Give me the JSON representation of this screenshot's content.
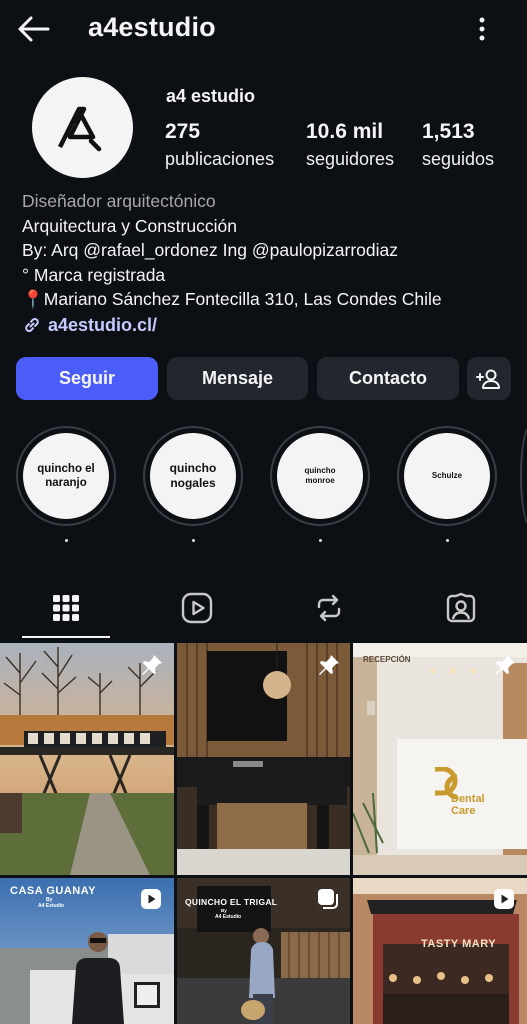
{
  "header": {
    "username": "a4estudio"
  },
  "profile": {
    "display_name": "a4 estudio",
    "stats": [
      {
        "value": "275",
        "label": "publicaciones"
      },
      {
        "value": "10.6 mil",
        "label": "seguidores"
      },
      {
        "value": "1,513",
        "label": "seguidos"
      }
    ],
    "category": "Diseñador arquitectónico",
    "bio": [
      "Arquitectura y Construcción",
      "By: Arq @rafael_ordonez Ing @paulopizarrodiaz",
      "° Marca registrada",
      "📍Mariano Sánchez Fontecilla 310, Las Condes Chile"
    ],
    "link": "a4estudio.cl/"
  },
  "actions": {
    "follow": "Seguir",
    "message": "Mensaje",
    "contact": "Contacto"
  },
  "highlights": [
    {
      "label": "quincho el naranjo"
    },
    {
      "label": "quincho nogales"
    },
    {
      "label": "quincho monroe"
    },
    {
      "label": "Schulze"
    }
  ],
  "tabs": [
    "grid",
    "reels",
    "reposts",
    "tagged"
  ],
  "posts": [
    {
      "type": "pinned"
    },
    {
      "type": "pinned"
    },
    {
      "type": "pinned",
      "sign": "RECEPCIÓN",
      "logo_line1": "Dental",
      "logo_line2": "Care"
    },
    {
      "type": "reel",
      "title": "CASA GUANAY",
      "by": "By",
      "studio": "A4 Estudio"
    },
    {
      "type": "reel",
      "title": "QUINCHO EL TRIGAL",
      "by": "By",
      "studio": "A4 Estudio"
    },
    {
      "type": "reel",
      "sign": "TASTY MARY"
    }
  ],
  "colors": {
    "background": "#0c0f14",
    "accent": "#4a5df9",
    "button": "#22262e",
    "link": "#c5cbff"
  }
}
